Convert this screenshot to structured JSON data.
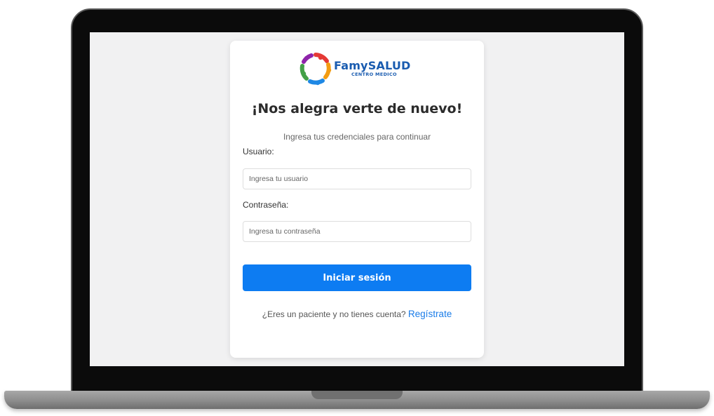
{
  "logo": {
    "name_part1": "Famy",
    "name_part2": "SALUD",
    "subtitle": "CENTRO MEDICO"
  },
  "login": {
    "title": "¡Nos alegra verte de nuevo!",
    "subtitle": "Ingresa tus credenciales para continuar",
    "username_label": "Usuario:",
    "username_placeholder": "Ingresa tu usuario",
    "username_value": "",
    "password_label": "Contraseña:",
    "password_placeholder": "Ingresa tu contraseña",
    "password_value": "",
    "submit_label": "Iniciar sesión",
    "register_prompt": "¿Eres un paciente y no tienes cuenta?",
    "register_link": "Regístrate"
  },
  "colors": {
    "primary_button": "#0d7cf2",
    "link": "#1a7ce8",
    "brand_blue": "#1a5cb0",
    "screen_background": "#f1f1f2"
  },
  "icons": {
    "logo": "people-circle-logo-icon"
  }
}
